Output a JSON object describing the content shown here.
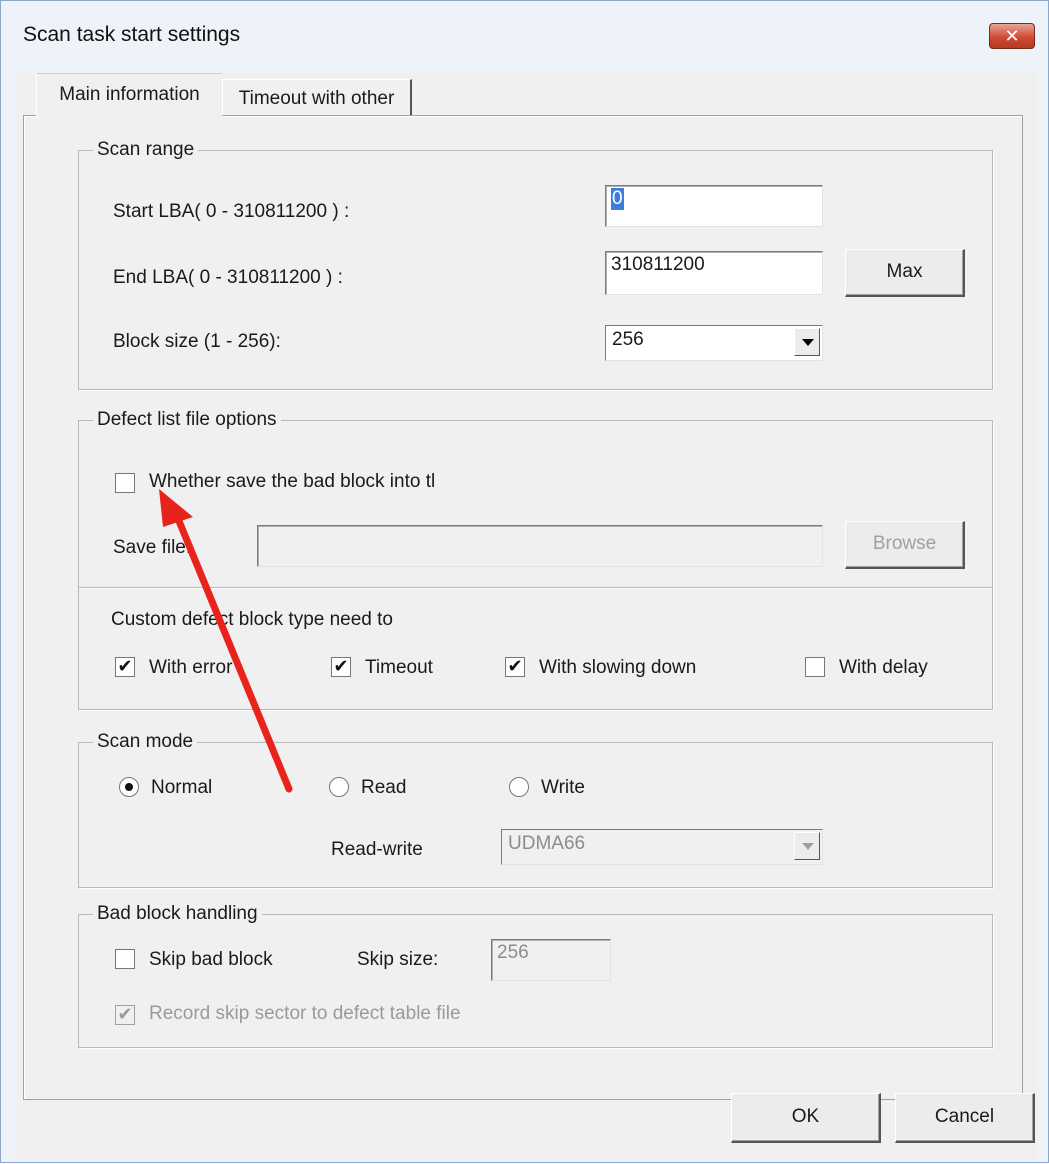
{
  "window": {
    "title": "Scan task start settings",
    "close_glyph": "✕"
  },
  "tabs": [
    {
      "label": "Main information",
      "active": true
    },
    {
      "label": "Timeout with other",
      "active": false
    }
  ],
  "scan_range": {
    "title": "Scan range",
    "start_lba_label": "Start LBA( 0 - 310811200 ) :",
    "start_lba_value": "0",
    "end_lba_label": "End LBA( 0 - 310811200 ) :",
    "end_lba_value": "310811200",
    "max_label": "Max",
    "block_size_label": "Block size (1 - 256):",
    "block_size_value": "256"
  },
  "defect_list": {
    "title": "Defect list file options",
    "save_bad_block_label": "Whether save the bad block into tl",
    "save_bad_block_checked": false,
    "save_file_label": "Save file:",
    "save_file_value": "",
    "browse_label": "Browse",
    "custom_type_label": "Custom defect block type need to",
    "types": [
      {
        "label": "With error",
        "checked": true
      },
      {
        "label": "Timeout",
        "checked": true
      },
      {
        "label": "With slowing down",
        "checked": true
      },
      {
        "label": "With delay",
        "checked": false
      }
    ]
  },
  "scan_mode": {
    "title": "Scan mode",
    "options": [
      {
        "label": "Normal",
        "selected": true
      },
      {
        "label": "Read",
        "selected": false
      },
      {
        "label": "Write",
        "selected": false
      }
    ],
    "read_write_label": "Read-write",
    "read_write_value": "UDMA66"
  },
  "bad_block": {
    "title": "Bad block handling",
    "skip_label": "Skip bad block",
    "skip_checked": false,
    "skip_size_label": "Skip size:",
    "skip_size_value": "256",
    "record_label": "Record skip sector to defect table file",
    "record_checked": true
  },
  "footer": {
    "ok_label": "OK",
    "cancel_label": "Cancel"
  },
  "colors": {
    "annotation_arrow": "#e8231c",
    "close_button": "#c9452e"
  },
  "check_glyph": "✔"
}
